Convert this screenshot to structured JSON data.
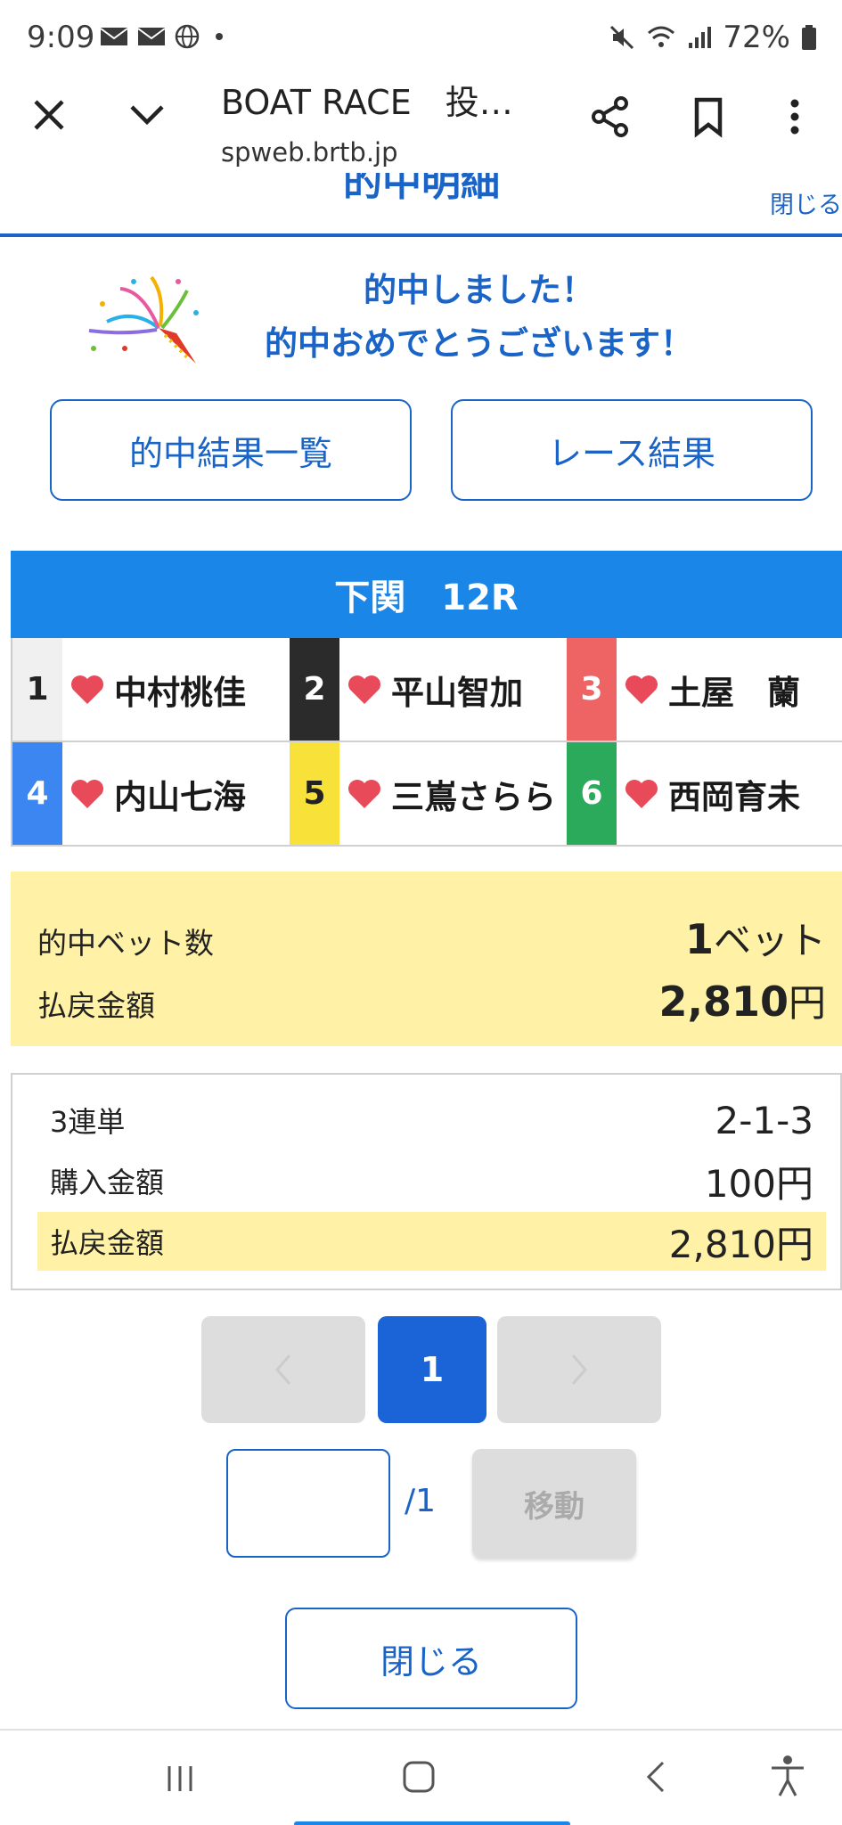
{
  "status": {
    "time": "9:09",
    "battery": "72%"
  },
  "browser": {
    "title": "BOAT RACE　投…",
    "url": "spweb.brtb.jp"
  },
  "page_header": {
    "title": "的中明細",
    "close": "閉じる"
  },
  "congrats": {
    "line1": "的中しました！",
    "line2": "的中おめでとうございます！"
  },
  "buttons": {
    "hit_list": "的中結果一覧",
    "race_result": "レース結果"
  },
  "race": {
    "title": "下関　12R"
  },
  "racers": [
    {
      "lane": "1",
      "name": "中村桃佳",
      "lane_color": "#f0f0f0",
      "text_color": "#222222"
    },
    {
      "lane": "2",
      "name": "平山智加",
      "lane_color": "#2b2b2b",
      "text_color": "#ffffff"
    },
    {
      "lane": "3",
      "name": "土屋　蘭",
      "lane_color": "#ee6464",
      "text_color": "#ffffff"
    },
    {
      "lane": "4",
      "name": "内山七海",
      "lane_color": "#3b86f0",
      "text_color": "#ffffff"
    },
    {
      "lane": "5",
      "name": "三嶌さらら",
      "lane_color": "#f8e23a",
      "text_color": "#222222"
    },
    {
      "lane": "6",
      "name": "西岡育未",
      "lane_color": "#2aaa5a",
      "text_color": "#ffffff"
    }
  ],
  "summary": {
    "bets_label": "的中ベット数",
    "bets_number": "1",
    "bets_unit": "ベット",
    "payout_label": "払戻金額",
    "payout_number": "2,810",
    "payout_unit": "円"
  },
  "detail": {
    "type_label": "3連単",
    "type_value": "2-1-3",
    "purchase_label": "購入金額",
    "purchase_value": "100円",
    "payout_label": "払戻金額",
    "payout_value": "2,810円"
  },
  "pager": {
    "prev": "‹",
    "current": "1",
    "next": "›",
    "total": "/1",
    "move": "移動"
  },
  "close_button": "閉じる",
  "colors": {
    "accent": "#1a64c8",
    "header_blue": "#1a86e8",
    "highlight": "#fff1a6",
    "heart": "#e84a5a"
  }
}
